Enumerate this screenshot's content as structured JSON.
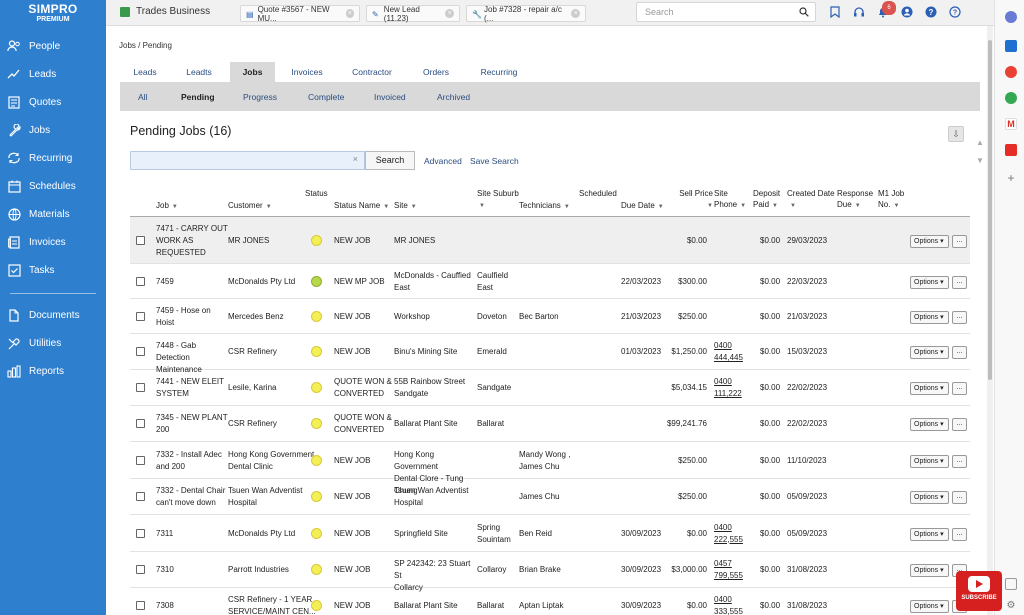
{
  "logo": {
    "line1": "SIMPRO",
    "line2": "PREMIUM"
  },
  "sidebar": {
    "items": [
      {
        "label": "People",
        "icon": "people-icon"
      },
      {
        "label": "Leads",
        "icon": "leads-icon"
      },
      {
        "label": "Quotes",
        "icon": "quotes-icon"
      },
      {
        "label": "Jobs",
        "icon": "jobs-icon"
      },
      {
        "label": "Recurring",
        "icon": "recurring-icon"
      },
      {
        "label": "Schedules",
        "icon": "schedules-icon"
      },
      {
        "label": "Materials",
        "icon": "materials-icon"
      },
      {
        "label": "Invoices",
        "icon": "invoices-icon"
      },
      {
        "label": "Tasks",
        "icon": "tasks-icon"
      }
    ],
    "items2": [
      {
        "label": "Documents",
        "icon": "documents-icon"
      },
      {
        "label": "Utilities",
        "icon": "utilities-icon"
      },
      {
        "label": "Reports",
        "icon": "reports-icon"
      }
    ]
  },
  "topbar": {
    "company": "Trades Business",
    "tabs": [
      "Quote #3567 - NEW MU...",
      "New Lead (11.23)",
      "Job #7328 - repair a/c (..."
    ],
    "search_placeholder": "Search",
    "notification_count": "6"
  },
  "breadcrumb": "Jobs / Pending",
  "main_tabs": [
    "Leads",
    "Leadts",
    "Jobs",
    "Invoices",
    "Contractor",
    "Orders",
    "Recurring"
  ],
  "sub_tabs": [
    "All",
    "Pending",
    "Progress",
    "Complete",
    "Invoiced",
    "Archived"
  ],
  "page_title": "Pending Jobs (16)",
  "search": {
    "value": "",
    "clear": "×",
    "button": "Search",
    "advanced": "Advanced",
    "save": "Save Search"
  },
  "table": {
    "headers": {
      "job": "Job",
      "customer": "Customer",
      "status": "Status",
      "status_name": "Status Name",
      "site": "Site",
      "site_suburb_1": "Site Suburb",
      "technicians": "Technicians",
      "scheduled": "Scheduled",
      "due_date": "Due Date",
      "sell_price": "Sell Price",
      "site_phone_1": "Site",
      "site_phone_2": "Phone",
      "deposit_1": "Deposit",
      "deposit_2": "Paid",
      "created": "Created Date",
      "response_1": "Response",
      "response_2": "Due",
      "m1_1": "M1 Job",
      "m1_2": "No."
    },
    "options_label": "Options ▾",
    "more_label": "...",
    "rows": [
      {
        "job": [
          "7471 - CARRY OUT",
          "WORK AS",
          "REQUESTED"
        ],
        "customer": [
          "MR JONES"
        ],
        "status_name": [
          "NEW JOB"
        ],
        "site": [
          "MR JONES"
        ],
        "suburb": [
          ""
        ],
        "tech": [
          ""
        ],
        "due": "",
        "price": "$0.00",
        "phone": [
          "",
          ""
        ],
        "deposit": "$0.00",
        "created": "29/03/2023",
        "dot": "yellow"
      },
      {
        "job": [
          "7459"
        ],
        "customer": [
          "McDonalds Pty Ltd"
        ],
        "status_name": [
          "NEW MP JOB"
        ],
        "site": [
          "McDonalds - Cauffied",
          "East"
        ],
        "suburb": [
          "Caulfield",
          "East"
        ],
        "tech": [
          ""
        ],
        "due": "22/03/2023",
        "price": "$300.00",
        "phone": [
          "",
          ""
        ],
        "deposit": "$0.00",
        "created": "22/03/2023",
        "dot": "green"
      },
      {
        "job": [
          "7459 - Hose on",
          "Hoist"
        ],
        "customer": [
          "Mercedes Benz"
        ],
        "status_name": [
          "NEW JOB"
        ],
        "site": [
          "Workshop"
        ],
        "suburb": [
          "Doveton"
        ],
        "tech": [
          "Bec Barton"
        ],
        "due": "21/03/2023",
        "price": "$250.00",
        "phone": [
          "",
          ""
        ],
        "deposit": "$0.00",
        "created": "21/03/2023",
        "dot": "yellow"
      },
      {
        "job": [
          "7448 - Gab Detection",
          "Maintenance"
        ],
        "customer": [
          "CSR Refinery"
        ],
        "status_name": [
          "NEW JOB"
        ],
        "site": [
          "Binu's Mining Site"
        ],
        "suburb": [
          "Emerald"
        ],
        "tech": [
          ""
        ],
        "due": "01/03/2023",
        "price": "$1,250.00",
        "phone": [
          "0400",
          "444,445"
        ],
        "deposit": "$0.00",
        "created": "15/03/2023",
        "dot": "yellow"
      },
      {
        "job": [
          "7441 - NEW ELEIT",
          "SYSTEM"
        ],
        "customer": [
          "Lesile, Karina"
        ],
        "status_name": [
          "QUOTE WON &",
          "CONVERTED"
        ],
        "site": [
          "55B Rainbow Street",
          "Sandgate"
        ],
        "suburb": [
          "Sandgate"
        ],
        "tech": [
          ""
        ],
        "due": "",
        "price": "$5,034.15",
        "phone": [
          "0400",
          "111,222"
        ],
        "deposit": "$0.00",
        "created": "22/02/2023",
        "dot": "yellow"
      },
      {
        "job": [
          "7345 - NEW PLANT",
          "200"
        ],
        "customer": [
          "CSR Refinery"
        ],
        "status_name": [
          "QUOTE WON &",
          "CONVERTED"
        ],
        "site": [
          "Ballarat Plant Site"
        ],
        "suburb": [
          "Ballarat"
        ],
        "tech": [
          ""
        ],
        "due": "",
        "price": "$99,241.76",
        "phone": [
          "",
          ""
        ],
        "deposit": "$0.00",
        "created": "22/02/2023",
        "dot": "yellow"
      },
      {
        "job": [
          "7332 - Install Adec",
          "and 200"
        ],
        "customer": [
          "Hong Kong Government",
          "Dental Clinic"
        ],
        "status_name": [
          "NEW JOB"
        ],
        "site": [
          "Hong Kong Government",
          "Dental Clore - Tung Chung"
        ],
        "suburb": [
          ""
        ],
        "tech": [
          "Mandy Wong ,",
          "James Chu"
        ],
        "due": "",
        "price": "$250.00",
        "phone": [
          "",
          ""
        ],
        "deposit": "$0.00",
        "created": "11/10/2023",
        "dot": "yellow"
      },
      {
        "job": [
          "7332 - Dental Chair",
          "can't move down"
        ],
        "customer": [
          "Tsuen Wan Adventist",
          "Hospital"
        ],
        "status_name": [
          "NEW JOB"
        ],
        "site": [
          "Tsuen Wan Adventist",
          "Hospital"
        ],
        "suburb": [
          ""
        ],
        "tech": [
          "James Chu"
        ],
        "due": "",
        "price": "$250.00",
        "phone": [
          "",
          ""
        ],
        "deposit": "$0.00",
        "created": "05/09/2023",
        "dot": "yellow"
      },
      {
        "job": [
          "7311"
        ],
        "customer": [
          "McDonalds Pty Ltd"
        ],
        "status_name": [
          "NEW JOB"
        ],
        "site": [
          "Springfield Site"
        ],
        "suburb": [
          "Spring",
          "Souintam"
        ],
        "tech": [
          "Ben Reid"
        ],
        "due": "30/09/2023",
        "price": "$0.00",
        "phone": [
          "0400",
          "222,555"
        ],
        "deposit": "$0.00",
        "created": "05/09/2023",
        "dot": "yellow"
      },
      {
        "job": [
          "7310"
        ],
        "customer": [
          "Parrott Industries"
        ],
        "status_name": [
          "NEW JOB"
        ],
        "site": [
          "SP 242342: 23 Stuart St",
          "Collarcy"
        ],
        "suburb": [
          "Collaroy"
        ],
        "tech": [
          "Brian Brake"
        ],
        "due": "30/09/2023",
        "price": "$3,000.00",
        "phone": [
          "0457",
          "799,555"
        ],
        "deposit": "$0.00",
        "created": "31/08/2023",
        "dot": "yellow"
      },
      {
        "job": [
          "7308"
        ],
        "customer": [
          "CSR Refinery - 1 YEAR",
          "SERVICE/MAINT CEN..."
        ],
        "status_name": [
          "NEW JOB"
        ],
        "site": [
          "Ballarat Plant Site"
        ],
        "suburb": [
          "Ballarat"
        ],
        "tech": [
          "Aptan Liptak"
        ],
        "due": "30/09/2023",
        "price": "$0.00",
        "phone": [
          "0400",
          "333,555"
        ],
        "deposit": "$0.00",
        "created": "31/08/2023",
        "dot": "yellow"
      }
    ]
  },
  "youtube": {
    "label": "SUBSCRIBE"
  },
  "colors": {
    "sidebar": "#2f7fcf",
    "status_yellow": "#f4ef55",
    "status_green": "#b6d94b",
    "link": "#2a4d80"
  }
}
